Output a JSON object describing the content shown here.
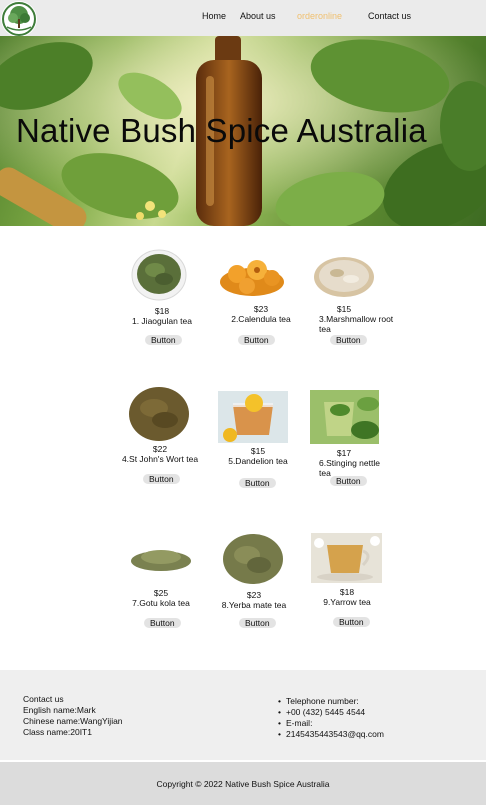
{
  "nav": {
    "items": [
      {
        "label": "Home",
        "color": "#111111"
      },
      {
        "label": "About us",
        "color": "#111111"
      },
      {
        "label": "orderonline",
        "color": "#f0c070"
      },
      {
        "label": "Contact us",
        "color": "#111111"
      }
    ]
  },
  "hero": {
    "title": "Native Bush Spice Australia"
  },
  "products": [
    {
      "price": "$18",
      "name": "1. Jiaogulan tea",
      "button": "Button"
    },
    {
      "price": "$23",
      "name": "2.Calendula tea",
      "button": "Button"
    },
    {
      "price": "$15",
      "name": "3.Marshmallow root tea",
      "button": "Button"
    },
    {
      "price": "$22",
      "name": "4.St John's Wort tea",
      "button": "Button"
    },
    {
      "price": "$15",
      "name": "5.Dandelion tea",
      "button": "Button"
    },
    {
      "price": "$17",
      "name": "6.Stinging nettle tea",
      "button": "Button"
    },
    {
      "price": "$25",
      "name": "7.Gotu kola tea",
      "button": "Button"
    },
    {
      "price": "$23",
      "name": "8.Yerba mate tea",
      "button": "Button"
    },
    {
      "price": "$18",
      "name": "9.Yarrow tea",
      "button": "Button"
    }
  ],
  "footer": {
    "contact_title": "Contact us",
    "english_name": "English name:Mark",
    "chinese_name": "Chinese name:WangYijian",
    "class_name": "Class name:20IT1",
    "contact_list": [
      "Telephone number:",
      "+00 (432) 5445 4544",
      "E-mail:",
      "2145435443543@qq.com"
    ]
  },
  "copyright": "Copyright © 2022 Native Bush Spice Australia"
}
